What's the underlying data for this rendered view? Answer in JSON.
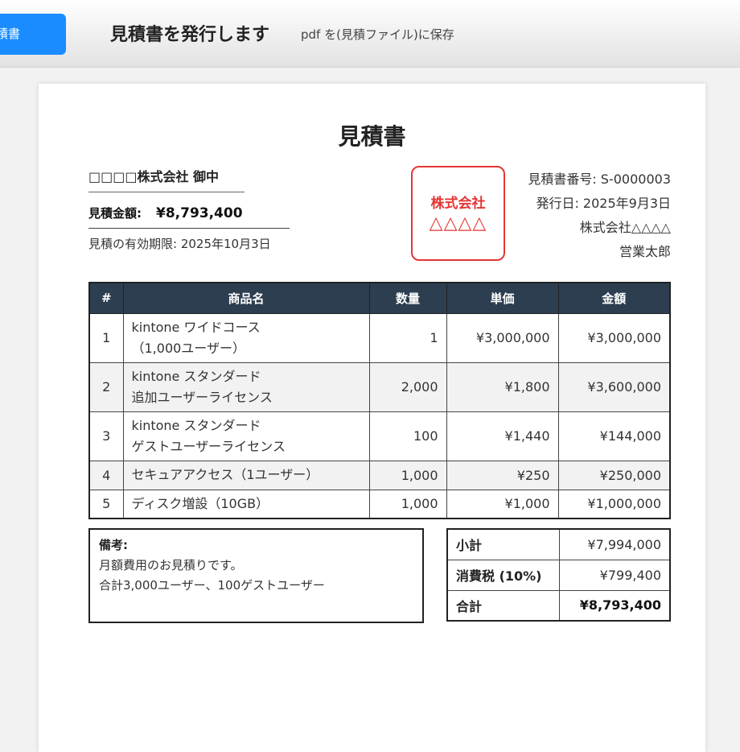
{
  "toolbar": {
    "issue_button_label": "見積書",
    "title": "見積書を発行します",
    "subtitle": "pdf を(見積ファイル)に保存"
  },
  "document": {
    "title": "見積書",
    "client": "□□□□株式会社 御中",
    "amount_label": "見積金額:",
    "amount_value": "¥8,793,400",
    "validity": "見積の有効期限: 2025年10月3日",
    "seal_line1": "株式会社",
    "seal_line2": "△△△△",
    "issuer": {
      "number": "見積書番号: S-0000003",
      "date": "発行日: 2025年9月3日",
      "company": "株式会社△△△△",
      "department": "営業太郎"
    },
    "table": {
      "headers": [
        "#",
        "商品名",
        "数量",
        "単価",
        "金額"
      ],
      "rows": [
        {
          "no": "1",
          "name1": "kintone ワイドコース",
          "name2": "（1,000ユーザー）",
          "qty": "1",
          "unit": "¥3,000,000",
          "amount": "¥3,000,000"
        },
        {
          "no": "2",
          "name1": "kintone スタンダード",
          "name2": "追加ユーザーライセンス",
          "qty": "2,000",
          "unit": "¥1,800",
          "amount": "¥3,600,000"
        },
        {
          "no": "3",
          "name1": "kintone スタンダード",
          "name2": "ゲストユーザーライセンス",
          "qty": "100",
          "unit": "¥1,440",
          "amount": "¥144,000"
        },
        {
          "no": "4",
          "name1": "セキュアアクセス（1ユーザー）",
          "name2": "",
          "qty": "1,000",
          "unit": "¥250",
          "amount": "¥250,000"
        },
        {
          "no": "5",
          "name1": "ディスク増設（10GB）",
          "name2": "",
          "qty": "1,000",
          "unit": "¥1,000",
          "amount": "¥1,000,000"
        }
      ]
    },
    "notes": {
      "title": "備考:",
      "line1": "月額費用のお見積りです。",
      "line2": "合計3,000ユーザー、100ゲストユーザー"
    },
    "totals": {
      "subtotal_label": "小計",
      "subtotal_value": "¥7,994,000",
      "tax_label": "消費税 (10%)",
      "tax_value": "¥799,400",
      "total_label": "合計",
      "total_value": "¥8,793,400"
    }
  }
}
